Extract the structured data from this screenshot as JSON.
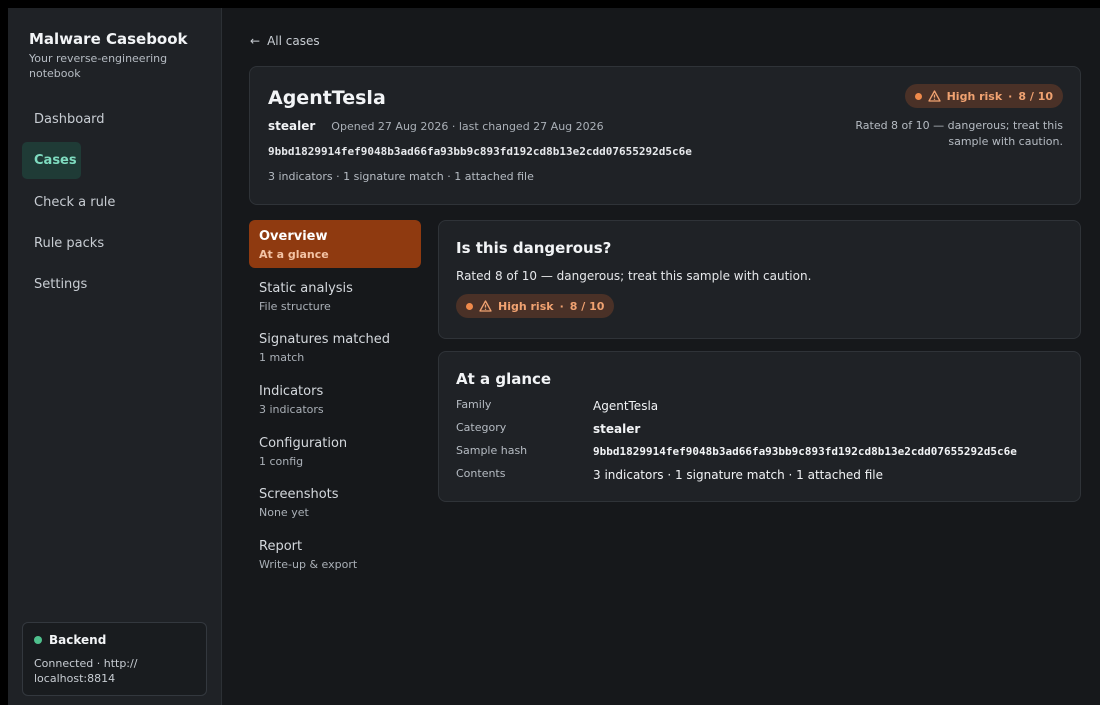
{
  "sidebar": {
    "brand_title": "Malware Casebook",
    "brand_subtitle": "Your reverse-engineering notebook",
    "nav": [
      {
        "label": "Dashboard",
        "active": false
      },
      {
        "label": "Cases",
        "active": true
      },
      {
        "label": "Check a rule",
        "active": false
      },
      {
        "label": "Rule packs",
        "active": false
      },
      {
        "label": "Settings",
        "active": false
      }
    ],
    "backend": {
      "title": "Backend",
      "status": "Connected · http:// localhost:8814",
      "status_color": "#4fc08d"
    }
  },
  "main": {
    "back_label": "All cases",
    "case": {
      "name": "AgentTesla",
      "category": "stealer",
      "dates": "Opened 27 Aug 2026 · last changed 27 Aug 2026",
      "hash": "9bbd1829914fef9048b3ad66fa93bb9c893fd192cd8b13e2cdd07655292d5c6e",
      "counts": "3 indicators · 1 signature match · 1 attached file",
      "risk_label": "High risk",
      "risk_score": "8 / 10",
      "rated_note": "Rated 8 of 10 — dangerous; treat this sample with caution."
    },
    "sections": [
      {
        "label": "Overview",
        "sub": "At a glance",
        "active": true
      },
      {
        "label": "Static analysis",
        "sub": "File structure",
        "active": false
      },
      {
        "label": "Signatures matched",
        "sub": "1 match",
        "active": false
      },
      {
        "label": "Indicators",
        "sub": "3 indicators",
        "active": false
      },
      {
        "label": "Configuration",
        "sub": "1 config",
        "active": false
      },
      {
        "label": "Screenshots",
        "sub": "None yet",
        "active": false
      },
      {
        "label": "Report",
        "sub": "Write-up & export",
        "active": false
      }
    ],
    "danger_card": {
      "title": "Is this dangerous?",
      "text": "Rated 8 of 10 — dangerous; treat this sample with caution.",
      "risk_label": "High risk",
      "risk_score": "8 / 10"
    },
    "glance_card": {
      "title": "At a glance",
      "rows": [
        {
          "key": "Family",
          "value": "AgentTesla"
        },
        {
          "key": "Category",
          "value": "stealer"
        },
        {
          "key": "Sample hash",
          "value": "9bbd1829914fef9048b3ad66fa93bb9c893fd192cd8b13e2cdd07655292d5c6e"
        },
        {
          "key": "Contents",
          "value": "3 indicators · 1 signature match · 1 attached file"
        }
      ]
    }
  },
  "colors": {
    "accent_active_nav": "#1f3b36",
    "accent_active_section": "#8f3a10",
    "risk_badge_bg": "#4a3127",
    "risk_badge_text": "#f0a271"
  },
  "icons": {
    "back": "arrow-left-icon",
    "warning": "warning-triangle-icon",
    "status": "status-dot-icon"
  }
}
